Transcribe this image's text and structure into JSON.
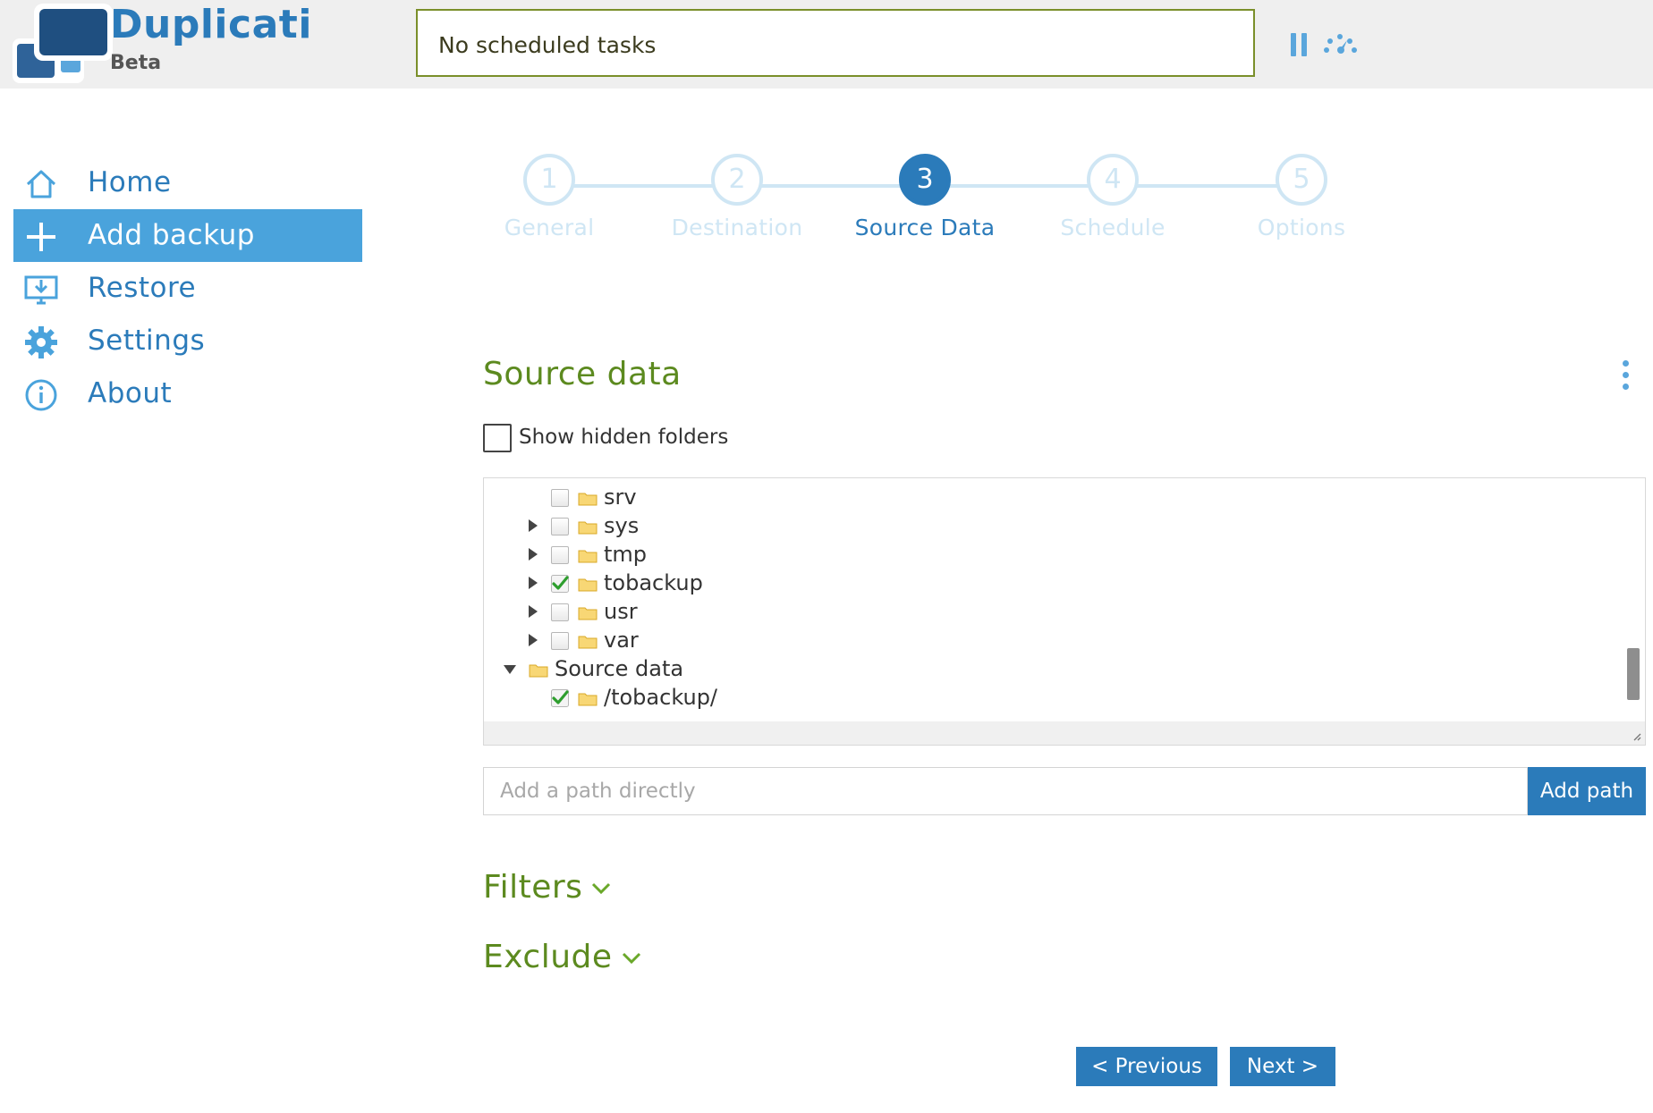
{
  "app": {
    "name": "Duplicati",
    "edition": "Beta"
  },
  "header": {
    "status_text": "No scheduled tasks",
    "pause_icon": "pause-icon",
    "throttle_icon": "speed-gauge-icon"
  },
  "sidebar": {
    "items": [
      {
        "label": "Home",
        "icon": "home-icon",
        "active": false
      },
      {
        "label": "Add backup",
        "icon": "plus-icon",
        "active": true
      },
      {
        "label": "Restore",
        "icon": "restore-icon",
        "active": false
      },
      {
        "label": "Settings",
        "icon": "gear-icon",
        "active": false
      },
      {
        "label": "About",
        "icon": "info-icon",
        "active": false
      }
    ]
  },
  "wizard": {
    "steps": [
      {
        "number": "1",
        "label": "General"
      },
      {
        "number": "2",
        "label": "Destination"
      },
      {
        "number": "3",
        "label": "Source Data"
      },
      {
        "number": "4",
        "label": "Schedule"
      },
      {
        "number": "5",
        "label": "Options"
      }
    ],
    "current_step": 3
  },
  "source": {
    "title": "Source data",
    "show_hidden_label": "Show hidden folders",
    "show_hidden_checked": false,
    "tree": [
      {
        "label": "srv",
        "expandable": false,
        "checked": false
      },
      {
        "label": "sys",
        "expandable": true,
        "checked": false
      },
      {
        "label": "tmp",
        "expandable": true,
        "checked": false
      },
      {
        "label": "tobackup",
        "expandable": true,
        "checked": true
      },
      {
        "label": "usr",
        "expandable": true,
        "checked": false
      },
      {
        "label": "var",
        "expandable": true,
        "checked": false
      }
    ],
    "selected_group": {
      "label": "Source data",
      "items": [
        {
          "label": "/tobackup/",
          "checked": true
        }
      ]
    },
    "path_placeholder": "Add a path directly",
    "path_value": "",
    "add_path_label": "Add path"
  },
  "sections": {
    "filters_label": "Filters",
    "exclude_label": "Exclude"
  },
  "footer": {
    "previous_label": "< Previous",
    "next_label": "Next >"
  },
  "colors": {
    "primary": "#2b7bba",
    "active_nav": "#4aa3dc",
    "section_green": "#5c8a1f",
    "step_inactive": "#cfe6f4",
    "status_border": "#7a8f2a"
  }
}
